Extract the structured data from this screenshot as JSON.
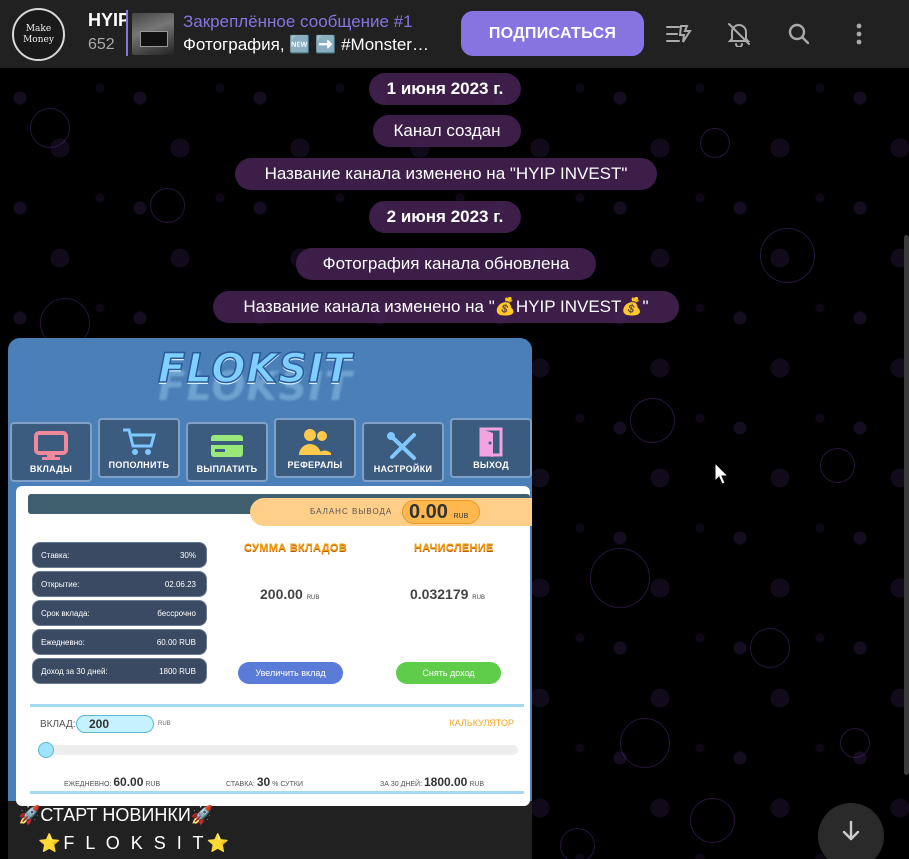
{
  "header": {
    "avatar_text": [
      "Make",
      "Money"
    ],
    "channel_title": "HYIP INVEST",
    "subscribers": "652",
    "pinned_label": "Закреплённое сообщение #1",
    "pinned_text": "Фотография, 🆕 ➡️ #Monster…",
    "subscribe_label": "ПОДПИСАТЬСЯ",
    "icons": [
      "topics-icon",
      "mute-bell-icon",
      "search-icon",
      "more-vertical-icon"
    ],
    "accent": "#8774e1"
  },
  "service_messages": [
    "1 июня 2023 г.",
    "Канал создан",
    "Название канала изменено на \"HYIP INVEST\"",
    "2 июня 2023 г.",
    "Фотография канала обновлена",
    "Название канала изменено на \"💰HYIP INVEST💰\""
  ],
  "post": {
    "screenshot": {
      "logo": "FLOKSIT",
      "menu": [
        {
          "label": "ВКЛАДЫ",
          "icon": "monitor-icon"
        },
        {
          "label": "ПОПОЛНИТЬ",
          "icon": "cart-icon"
        },
        {
          "label": "ВЫПЛАТИТЬ",
          "icon": "card-icon"
        },
        {
          "label": "РЕФЕРАЛЫ",
          "icon": "users-icon"
        },
        {
          "label": "НАСТРОЙКИ",
          "icon": "tools-icon"
        },
        {
          "label": "ВЫХОД",
          "icon": "door-icon"
        }
      ],
      "balance_label": "БАЛАНС ВЫВОДА",
      "balance_value": "0.00",
      "currency": "RUB",
      "stats": [
        {
          "k": "Ставка:",
          "v": "30%"
        },
        {
          "k": "Открытие:",
          "v": "02.06.23"
        },
        {
          "k": "Срок вклада:",
          "v": "бессрочно"
        },
        {
          "k": "Ежедневно:",
          "v": "60.00 RUB"
        },
        {
          "k": "Доход за 30 дней:",
          "v": "1800 RUB"
        }
      ],
      "sum_title": "СУММА ВКЛАДОВ",
      "sum_value": "200.00",
      "accrual_title": "НАЧИСЛЕНИЕ",
      "accrual_value": "0.032179",
      "increase_label": "Увеличить вклад",
      "withdraw_label": "Снять доход",
      "calc": {
        "label": "ВКЛАД:",
        "value": "200",
        "title": "КАЛЬКУЛЯТОР",
        "daily_label": "ЕЖЕДНЕВНО:",
        "daily_value": "60.00",
        "rate_label": "СТАВКА:",
        "rate_value": "30",
        "rate_unit": "% СУТКИ",
        "month_label": "ЗА 30 ДНЕЙ:",
        "month_value": "1800.00"
      }
    },
    "caption_line1": "🚀СТАРТ  НОВИНКИ🚀",
    "caption_line2": "⭐F L O K S I T⭐"
  }
}
